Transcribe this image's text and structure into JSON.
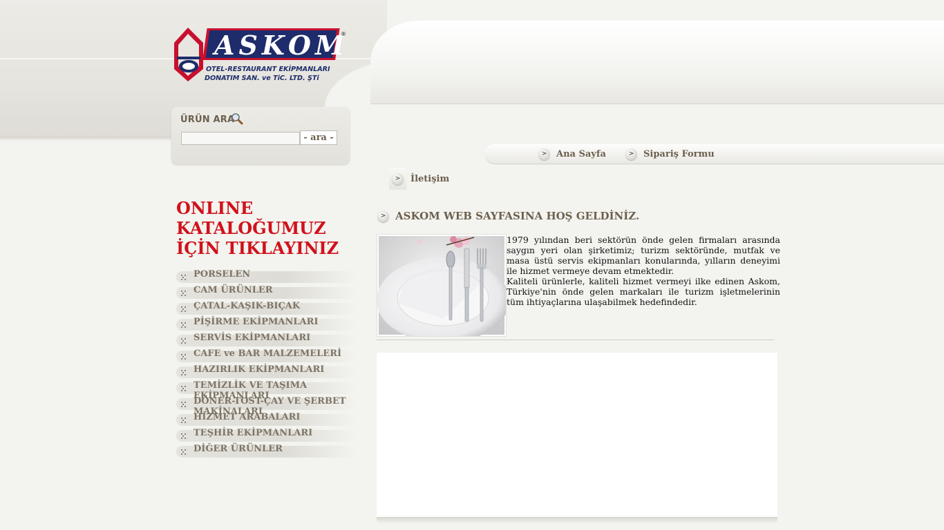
{
  "brand": {
    "name": "ASKOM",
    "registered": "®",
    "tagline_line1": "OTEL-RESTAURANT EKİPMANLARI",
    "tagline_line2": "DONATIM SAN. ve TiC. LTD. ŞTi",
    "colors": {
      "red": "#c8102e",
      "navy": "#1e2c6b"
    }
  },
  "search": {
    "title": "ÜRÜN ARA",
    "icon": "magnifier-icon",
    "value": "",
    "button_label": "- ara -"
  },
  "nav": {
    "items": [
      {
        "label": "Ana Sayfa",
        "icon": "arrow-right-icon"
      },
      {
        "label": "Sipariş Formu",
        "icon": "arrow-right-icon"
      },
      {
        "label": "İletişim",
        "icon": "arrow-right-icon"
      }
    ]
  },
  "catalog": {
    "line1": "ONLINE",
    "line2": "KATALOĞUMUZ",
    "line3": "İÇİN TIKLAYINIZ",
    "color": "#d0121b"
  },
  "categories": [
    "PORSELEN",
    "CAM ÜRÜNLER",
    "ÇATAL-KAŞIK-BIÇAK",
    "PİŞİRME EKİPMANLARI",
    "SERVİS EKİPMANLARI",
    "CAFE ve BAR MALZEMELERİ",
    "HAZIRLIK EKİPMANLARI",
    "TEMİZLİK VE TAŞIMA EKİPMANLARI",
    "DÖNER-TOST-ÇAY VE ŞERBET MAKİNALARI",
    "HİZMET ARABALARI",
    "TEŞHİR EKİPMANLARI",
    "DİĞER ÜRÜNLER"
  ],
  "welcome": {
    "title": "ASKOM WEB SAYFASINA HOŞ GELDİNİZ.",
    "paragraph1": "1979 yılından beri sektörün önde gelen firmaları arasında saygın yeri olan şirketimiz; turizm sektöründe, mutfak ve masa üstü servis ekipmanları konularında, yılların deneyimi ile hizmet vermeye devam etmektedir.",
    "paragraph2": "Kaliteli ürünlerle, kaliteli hizmet vermeyi ilke edinen Askom, Türkiye'nin önde gelen markaları ile turizm işletmelerinin tüm ihtiyaçlarına ulaşabilmek hedefindedir."
  }
}
